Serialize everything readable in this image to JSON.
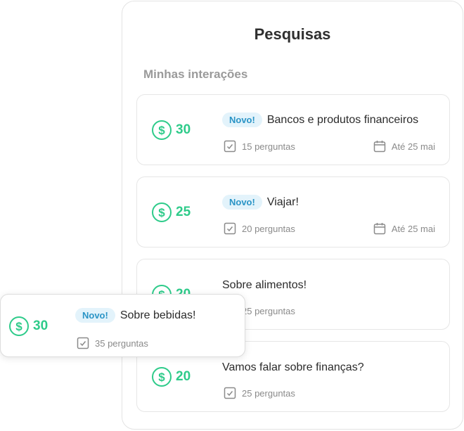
{
  "page": {
    "title": "Pesquisas",
    "section_title": "Minhas interações",
    "new_badge": "Novo!",
    "coin_symbol": "$"
  },
  "colors": {
    "accent_green": "#2ecb8a",
    "badge_bg": "#e3f3fb",
    "badge_text": "#2a94c6"
  },
  "surveys": [
    {
      "points": "30",
      "badge": "Novo!",
      "title": "Bancos e produtos financeiros",
      "questions": "15 perguntas",
      "deadline": "Até 25 mai"
    },
    {
      "points": "25",
      "badge": "Novo!",
      "title": "Viajar!",
      "questions": "20 perguntas",
      "deadline": "Até 25 mai"
    },
    {
      "points": "20",
      "title": "Sobre alimentos!",
      "questions": "25 perguntas"
    },
    {
      "points": "20",
      "title": "Vamos falar sobre finanças?",
      "questions": "25 perguntas"
    }
  ],
  "floating_card": {
    "points": "30",
    "badge": "Novo!",
    "title": "Sobre bebidas!",
    "questions": "35 perguntas"
  },
  "icons": {
    "coin": "dollar-coin-icon",
    "questions": "checklist-icon",
    "deadline": "calendar-icon"
  }
}
